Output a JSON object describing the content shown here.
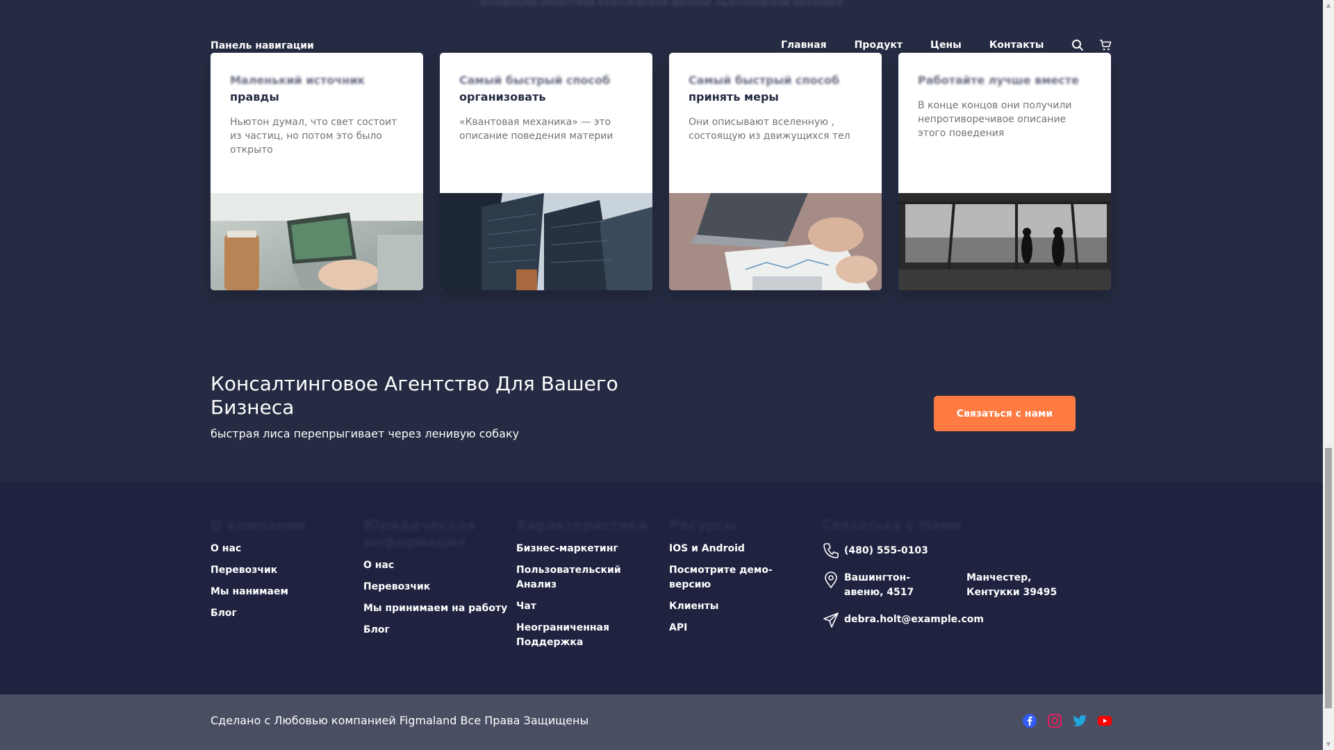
{
  "top_text": "основными областями классической физики: ньютоновской механики",
  "nav": {
    "brand": "Панель навигации",
    "links": [
      "Главная",
      "Продукт",
      "Цены",
      "Контакты"
    ]
  },
  "cards": [
    {
      "title_blur": "Маленький источник",
      "title": "правды",
      "desc": "Ньютон думал, что свет состоит из частиц, но потом это было открыто"
    },
    {
      "title_blur": "Самый быстрый способ",
      "title": "организовать",
      "desc": "«Квантовая механика» — это описание поведения материи"
    },
    {
      "title_blur": "Самый быстрый способ",
      "title": "принять меры",
      "desc": "Они описывают вселенную , состоящую из движущихся тел"
    },
    {
      "title_blur": "Работайте лучше вместе",
      "title": "",
      "desc": "В конце концов они получили непротиворечивое описание этого поведения"
    }
  ],
  "cta": {
    "title": "Консалтинговое Агентство Для Вашего Бизнеса",
    "subtitle": "быстрая лиса перепрыгивает через ленивую собаку",
    "button": "Связаться с нами"
  },
  "footer": {
    "columns": [
      {
        "title": "О компании",
        "links": [
          "О нас",
          "Перевозчик",
          "Мы нанимаем",
          "Блог"
        ]
      },
      {
        "title": "Юридическая информация",
        "links": [
          "О нас",
          "Перевозчик",
          "Мы принимаем на работу",
          "Блог"
        ]
      },
      {
        "title": "Характеристики",
        "links": [
          "Бизнес-маркетинг",
          "Пользовательский Анализ",
          "Чат",
          "Неограниченная Поддержка"
        ]
      },
      {
        "title": "Ресурсы",
        "links": [
          "IOS и Android",
          "Посмотрите демо-версию",
          "Клиенты",
          "API"
        ]
      }
    ],
    "contact": {
      "title": "Связаться с Нами",
      "phone": "(480) 555-0103",
      "address_1": "Вашингтон-авеню, 4517",
      "address_2": "Манчестер, Кентукки 39495",
      "email": "debra.holt@example.com"
    }
  },
  "bottom": {
    "copyright": "Сделано с Любовью компанией Figmaland Все Права Защищены",
    "socials": [
      "facebook-icon",
      "instagram-icon",
      "twitter-icon",
      "youtube-icon"
    ]
  },
  "colors": {
    "background": "#252b42",
    "footer": "#1f2340",
    "bottom": "#4a4e63",
    "accent": "#ff7b42",
    "facebook": "#335bf5",
    "instagram": "#e51f5a",
    "twitter": "#21a6df",
    "youtube": "#ff0000"
  }
}
